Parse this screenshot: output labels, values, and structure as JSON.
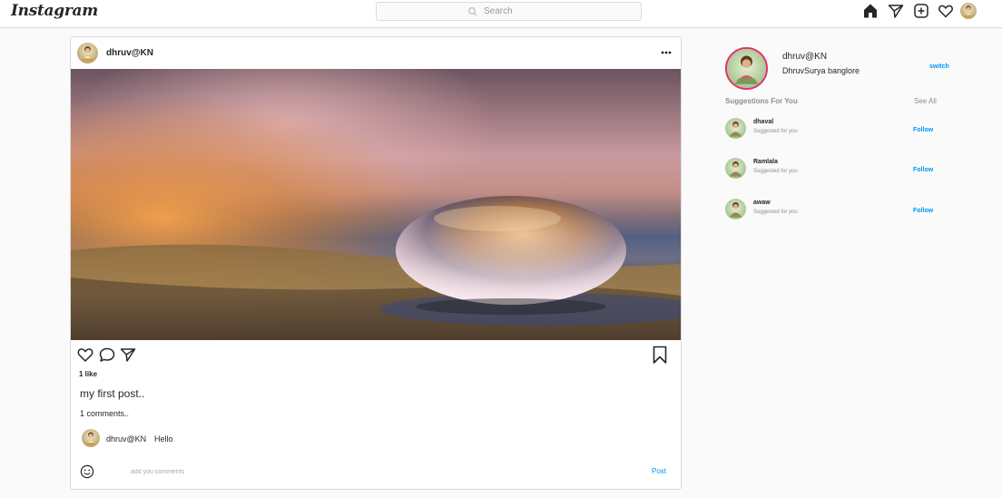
{
  "nav": {
    "logo": "Instagram",
    "search_placeholder": "Search",
    "icons": [
      "home-icon",
      "direct-icon",
      "new-post-icon",
      "activity-icon",
      "profile-avatar"
    ]
  },
  "post": {
    "username": "dhruv@KN",
    "likes": "1 like",
    "caption": "my first post..",
    "comments_count": "1 comments..",
    "comment": {
      "username": "dhruv@KN",
      "text": "Hello"
    },
    "add_comment_placeholder": "add you comments",
    "post_button": "Post"
  },
  "sidebar": {
    "username": "dhruv@KN",
    "subtitle": "DhruvSurya banglore",
    "switch_label": "switch",
    "suggestions_title": "Suggestions For You",
    "see_all": "See All",
    "suggestions": [
      {
        "name": "dhaval",
        "subtitle": "Suggested for you",
        "action": "Follow"
      },
      {
        "name": "Ramlala",
        "subtitle": "Suggested for you",
        "action": "Follow"
      },
      {
        "name": "awaw",
        "subtitle": "Suggested for you",
        "action": "Follow"
      }
    ]
  },
  "colors": {
    "accent": "#0095f6",
    "border": "#dbdbdb",
    "background": "#fafafa",
    "ring": "#e1306c"
  }
}
